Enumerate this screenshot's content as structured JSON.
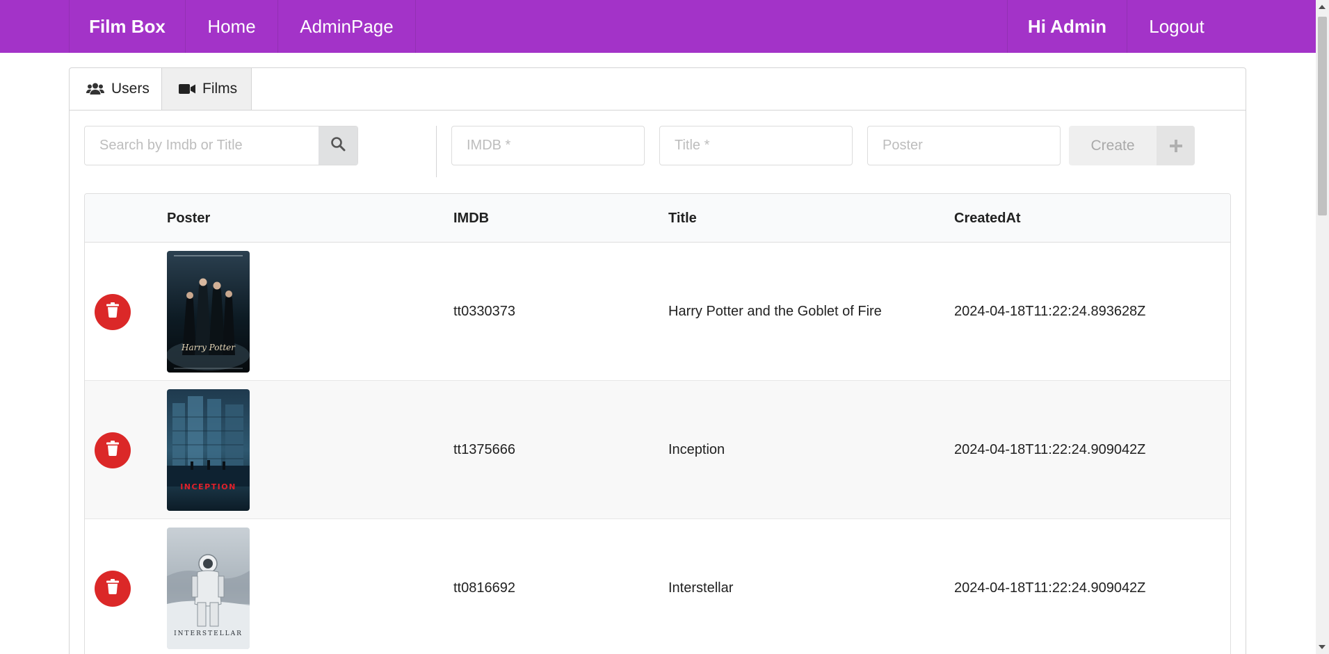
{
  "nav": {
    "brand": "Film Box",
    "home": "Home",
    "admin": "AdminPage",
    "greeting": "Hi Admin",
    "logout": "Logout"
  },
  "tabs": [
    {
      "label": "Users",
      "icon": "users-icon",
      "active": false
    },
    {
      "label": "Films",
      "icon": "video-camera-icon",
      "active": true
    }
  ],
  "search": {
    "placeholder": "Search by Imdb or Title",
    "value": ""
  },
  "create_form": {
    "imdb_placeholder": "IMDB *",
    "title_placeholder": "Title *",
    "poster_placeholder": "Poster",
    "create_label": "Create"
  },
  "table": {
    "columns": [
      "",
      "Poster",
      "IMDB",
      "Title",
      "CreatedAt"
    ],
    "rows": [
      {
        "imdb": "tt0330373",
        "title": "Harry Potter and the Goblet of Fire",
        "created_at": "2024-04-18T11:22:24.893628Z",
        "poster_caption": "Harry Potter"
      },
      {
        "imdb": "tt1375666",
        "title": "Inception",
        "created_at": "2024-04-18T11:22:24.909042Z",
        "poster_caption": "INCEPTION"
      },
      {
        "imdb": "tt0816692",
        "title": "Interstellar",
        "created_at": "2024-04-18T11:22:24.909042Z",
        "poster_caption": "INTERSTELLAR"
      }
    ]
  },
  "colors": {
    "nav_bg": "#a333c8",
    "delete_red": "#db2828",
    "active_tab_bg": "#efefef"
  }
}
